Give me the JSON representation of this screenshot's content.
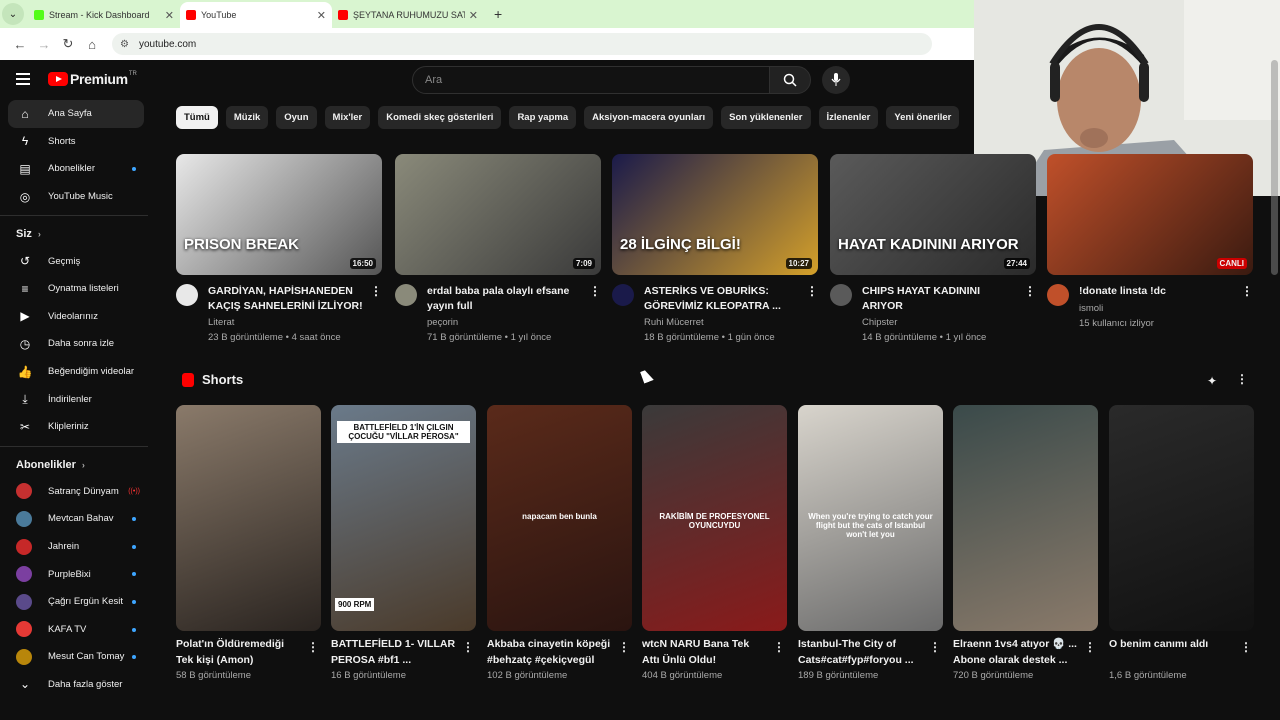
{
  "browser": {
    "tabs": [
      {
        "title": "Stream - Kick Dashboard",
        "favicon_color": "#53fc18",
        "active": false
      },
      {
        "title": "YouTube",
        "favicon_color": "#ff0000",
        "active": true
      },
      {
        "title": "ŞEYTANA RUHUMUZU SATTIK",
        "favicon_color": "#ff0000",
        "active": false
      }
    ],
    "url": "youtube.com",
    "new_tab": "+"
  },
  "header": {
    "logo": "Premium",
    "logo_region": "TR",
    "search_placeholder": "Ara"
  },
  "sidebar": {
    "main": [
      {
        "label": "Ana Sayfa",
        "icon": "home-icon",
        "glyph": "⌂"
      },
      {
        "label": "Shorts",
        "icon": "shorts-icon",
        "glyph": "ϟ"
      },
      {
        "label": "Abonelikler",
        "icon": "subscriptions-icon",
        "glyph": "▤"
      },
      {
        "label": "YouTube Music",
        "icon": "music-icon",
        "glyph": "◎"
      }
    ],
    "you_header": "Siz",
    "you": [
      {
        "label": "Geçmiş",
        "icon": "history-icon",
        "glyph": "↺"
      },
      {
        "label": "Oynatma listeleri",
        "icon": "playlist-icon",
        "glyph": "≡"
      },
      {
        "label": "Videolarınız",
        "icon": "your-videos-icon",
        "glyph": "▶"
      },
      {
        "label": "Daha sonra izle",
        "icon": "watch-later-icon",
        "glyph": "◷"
      },
      {
        "label": "Beğendiğim videolar",
        "icon": "like-icon",
        "glyph": "👍"
      },
      {
        "label": "İndirilenler",
        "icon": "download-icon",
        "glyph": "⤓"
      },
      {
        "label": "Klipleriniz",
        "icon": "clips-icon",
        "glyph": "✂"
      }
    ],
    "subs_header": "Abonelikler",
    "subs": [
      {
        "label": "Satranç Dünyam",
        "color": "#c53030",
        "live": true
      },
      {
        "label": "Mevtcan Bahav",
        "color": "#4a7a9a",
        "live": false
      },
      {
        "label": "Jahrein",
        "color": "#c62828",
        "live": false
      },
      {
        "label": "PurpleBixi",
        "color": "#7b3fa0",
        "live": false
      },
      {
        "label": "Çağrı Ergün Kesit",
        "color": "#5a4a8a",
        "live": false
      },
      {
        "label": "KAFA TV",
        "color": "#e53935",
        "live": false
      },
      {
        "label": "Mesut Can Tomay",
        "color": "#b8860b",
        "live": false
      }
    ],
    "more": "Daha fazla göster",
    "live_label": "((•))"
  },
  "chips": [
    "Tümü",
    "Müzik",
    "Oyun",
    "Mix'ler",
    "Komedi skeç gösterileri",
    "Rap yapma",
    "Aksiyon-macera oyunları",
    "Son yüklenenler",
    "İzlenenler",
    "Yeni öneriler"
  ],
  "videos": [
    {
      "title": "GARDİYAN, HAPİSHANEDEN KAÇIŞ SAHNELERİNİ İZLİYOR! ...",
      "channel": "Literat",
      "meta": "23 B görüntüleme • 4 saat önce",
      "duration": "16:50",
      "overlay": "PRISON BREAK",
      "colors": [
        "#e8e8e8",
        "#555"
      ]
    },
    {
      "title": "erdal baba pala olaylı efsane yayın full",
      "channel": "peçorin",
      "meta": "71 B görüntüleme • 1 yıl önce",
      "duration": "7:09",
      "overlay": "",
      "colors": [
        "#8a8a7a",
        "#3a3a3a"
      ]
    },
    {
      "title": "ASTERİKS VE OBURİKS: GÖREVİMİZ KLEOPATRA ...",
      "channel": "Ruhi Mücerret",
      "meta": "18 B görüntüleme • 1 gün önce",
      "duration": "10:27",
      "overlay": "28 İLGİNÇ BİLGİ!",
      "colors": [
        "#1a1a4a",
        "#d4a02a"
      ]
    },
    {
      "title": "CHIPS HAYAT KADININI ARIYOR",
      "channel": "Chipster",
      "meta": "14 B görüntüleme • 1 yıl önce",
      "duration": "27:44",
      "overlay": "HAYAT KADININI ARIYOR",
      "colors": [
        "#5a5a5a",
        "#2a2a2a"
      ]
    },
    {
      "title": "!donate linsta !dc",
      "channel": "ismoli",
      "meta": "15 kullanıcı izliyor",
      "duration": "CANLI",
      "overlay": "",
      "colors": [
        "#c0502a",
        "#3a1a10"
      ]
    }
  ],
  "shorts_title": "Shorts",
  "shorts": [
    {
      "title": "Polat'ın Öldüremediği Tek kişi (Amon)",
      "views": "58 B görüntüleme",
      "overlay": "",
      "colors": [
        "#8a7a6a",
        "#2a2420"
      ]
    },
    {
      "title": "BATTLEFİELD 1- VILLAR PEROSA #bf1 ...",
      "views": "16 B görüntüleme",
      "overlay": "BATTLEFİELD 1'İN ÇILGIN ÇOCUĞU \"VİLLAR PEROSA\"",
      "badge": "900 RPM",
      "colors": [
        "#6a7a8a",
        "#4a3a2a"
      ]
    },
    {
      "title": "Akbaba cinayetin köpeği #behzatç #çekiçvegül",
      "views": "102 B görüntüleme",
      "overlay": "napacam ben bunla",
      "colors": [
        "#5a2a1a",
        "#2a1410"
      ]
    },
    {
      "title": "wtcN NARU Bana Tek Attı Ünlü Oldu!",
      "views": "404 B görüntüleme",
      "overlay": "RAKİBİM DE PROFESYONEL OYUNCUYDU",
      "colors": [
        "#3a3a3a",
        "#8a1a1a"
      ]
    },
    {
      "title": "Istanbul-The City of Cats#cat#fyp#foryou ...",
      "views": "189 B görüntüleme",
      "overlay": "When you're trying to catch your flight but the cats of Istanbul won't let you",
      "colors": [
        "#d8d4cc",
        "#6a6a6a"
      ]
    },
    {
      "title": "Elraenn 1vs4 atıyor 💀 ... Abone olarak destek ...",
      "views": "720 B görüntüleme",
      "overlay": "",
      "colors": [
        "#3a4a4a",
        "#8a7a6a"
      ]
    },
    {
      "title": "O benim canımı aldı",
      "views": "1,6 B görüntüleme",
      "overlay": "",
      "colors": [
        "#2a2a2a",
        "#111"
      ]
    }
  ]
}
